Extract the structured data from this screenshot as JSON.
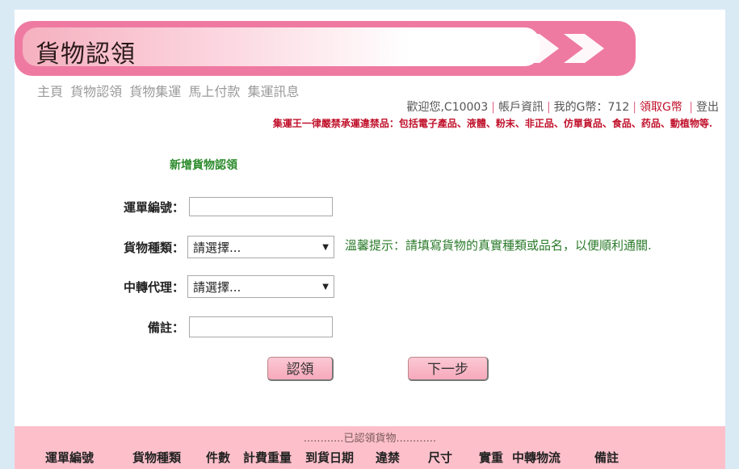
{
  "header": {
    "title": "貨物認領"
  },
  "nav": {
    "items": [
      "主頁",
      "貨物認領",
      "貨物集運",
      "馬上付款",
      "集運訊息"
    ]
  },
  "userbar": {
    "welcome": "歡迎您,C10003",
    "account": "帳戶資訊",
    "coins": "我的G幣：712",
    "get_coins": "領取G幣",
    "logout": "登出"
  },
  "warning": "集運王一律嚴禁承運違禁品：包括電子產品、液體、粉末、非正品、仿單貨品、食品、药品、動植物等.",
  "form": {
    "title": "新增貨物認領",
    "waybill_label": "運單編號：",
    "waybill_value": "",
    "type_label": "貨物種類：",
    "type_value": "請選擇...",
    "agent_label": "中轉代理：",
    "agent_value": "請選擇...",
    "note_label": "備註：",
    "note_value": "",
    "hint": "溫馨提示：請填寫貨物的真實種類或品名，以便順利通關.",
    "claim_button": "認領",
    "next_button": "下一步"
  },
  "claimed": {
    "caption": "............已認領貨物............",
    "columns": [
      "運單編號",
      "貨物種類",
      "件數",
      "計費重量",
      "到貨日期",
      "違禁",
      "尺寸",
      "實重",
      "中轉物流",
      "備註"
    ]
  },
  "colors": {
    "banner": "#ee7aa2",
    "accent_red": "#c0102a",
    "hint_green": "#2a7a2a",
    "table_bg": "#fdc0cb"
  }
}
